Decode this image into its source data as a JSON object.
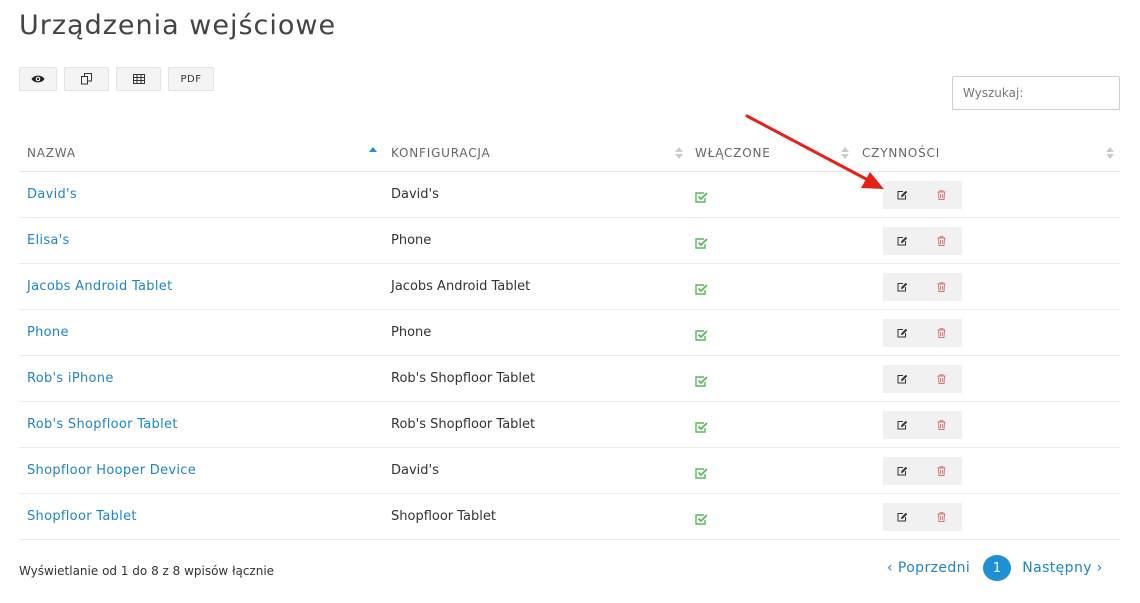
{
  "page": {
    "title": "Urządzenia wejściowe"
  },
  "toolbar": {
    "pdf_label": "PDF"
  },
  "search": {
    "placeholder": "Wyszukaj:"
  },
  "table": {
    "columns": {
      "name": "NAZWA",
      "config": "KONFIGURACJA",
      "enabled": "WŁĄCZONE",
      "actions": "CZYNNOŚCI"
    },
    "rows": [
      {
        "name": "David's",
        "config": "David's",
        "enabled": true
      },
      {
        "name": "Elisa's",
        "config": "Phone",
        "enabled": true
      },
      {
        "name": "Jacobs Android Tablet",
        "config": "Jacobs Android Tablet",
        "enabled": true
      },
      {
        "name": "Phone",
        "config": "Phone",
        "enabled": true
      },
      {
        "name": "Rob's iPhone",
        "config": "Rob's Shopfloor Tablet",
        "enabled": true
      },
      {
        "name": "Rob's Shopfloor Tablet",
        "config": "Rob's Shopfloor Tablet",
        "enabled": true
      },
      {
        "name": "Shopfloor Hooper Device",
        "config": "David's",
        "enabled": true
      },
      {
        "name": "Shopfloor Tablet",
        "config": "Shopfloor Tablet",
        "enabled": true
      }
    ]
  },
  "footer": {
    "info": "Wyświetlanie od 1 do 8 z 8 wpisów łącznie"
  },
  "pagination": {
    "prev": "‹ Poprzedni",
    "current": "1",
    "next": "Następny ›"
  },
  "colors": {
    "link": "#1e86c4",
    "check": "#5cb85c",
    "delete": "#e07070",
    "annotation": "#e8201a"
  }
}
